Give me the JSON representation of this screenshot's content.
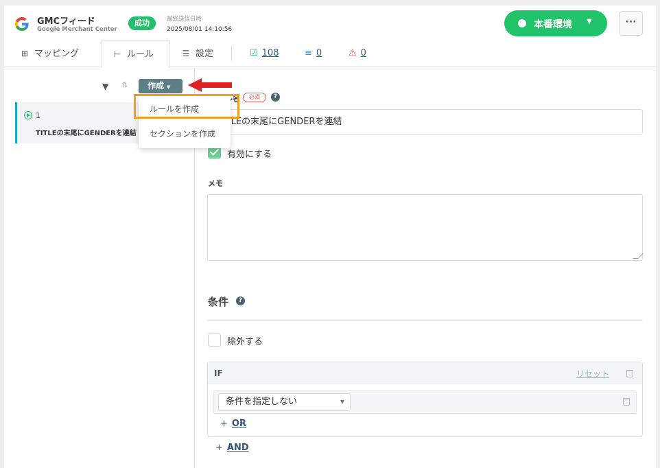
{
  "header": {
    "app_name": "GMCフィード",
    "app_sub": "Google Merchant Center",
    "status_badge": "成功",
    "last_sent_label": "最終送信日時",
    "last_sent_value": "2025/08/01 14:10:56",
    "env_button": "本番環境",
    "more_button": "···"
  },
  "tabs": [
    {
      "label": "マッピング",
      "icon": "mapping-icon"
    },
    {
      "label": "ルール",
      "icon": "rule-tree-icon"
    },
    {
      "label": "設定",
      "icon": "settings-sliders-icon"
    }
  ],
  "counts": {
    "ok": "108",
    "excluded": "0",
    "warning": "0"
  },
  "left": {
    "create_button": "作成",
    "rule_number": "1",
    "rule_title": "TITLEの末尾にGENDERを連結"
  },
  "dropdown": {
    "items": [
      "ルールを作成",
      "セクションを作成"
    ]
  },
  "form": {
    "name_label": "ルール名",
    "required_badge": "必須",
    "name_value": "TITLEの末尾にGENDERを連結",
    "enable_label": "有効にする",
    "memo_label": "メモ",
    "conditions_title": "条件",
    "exclude_label": "除外する",
    "if_label": "IF",
    "reset_label": "リセット",
    "condition_select": "条件を指定しない",
    "or_label": "OR",
    "and_label": "AND"
  },
  "colors": {
    "accent_green": "#20c26a",
    "create_button": "#5d7e86",
    "highlight_box": "#f0a020",
    "arrow_red": "#e02020",
    "link_blue": "#35557a"
  }
}
